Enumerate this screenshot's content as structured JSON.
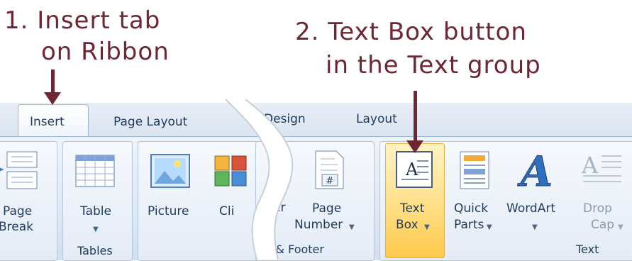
{
  "callouts": {
    "step1_line1": "1. Insert tab",
    "step1_line2": "on Ribbon",
    "step2_line1": "2. Text Box button",
    "step2_line2": "in the Text group"
  },
  "tabs": {
    "insert": "Insert",
    "page_layout": "Page Layout",
    "design": "Design",
    "layout": "Layout"
  },
  "buttons": {
    "page_break_line1": "Page",
    "page_break_line2": "Break",
    "table": "Table",
    "picture": "Picture",
    "clip_partial": "Cli",
    "footer_partial": "oter",
    "page_number_line1": "Page",
    "page_number_line2": "Number",
    "text_box_line1": "Text",
    "text_box_line2": "Box",
    "quick_parts_line1": "Quick",
    "quick_parts_line2": "Parts",
    "wordart": "WordArt",
    "drop_cap_line1": "Drop",
    "drop_cap_line2": "Cap"
  },
  "groups": {
    "tables": "Tables",
    "header_footer_partial": "er & Footer",
    "text": "Text"
  },
  "icons": {
    "text_box_letter": "A",
    "wordart_letter": "A",
    "drop_cap_letter": "A",
    "page_number_symbol": "#"
  },
  "colors": {
    "callout": "#6e2633",
    "highlight": "#ffd565",
    "ribbon_text": "#1f3a5d"
  }
}
